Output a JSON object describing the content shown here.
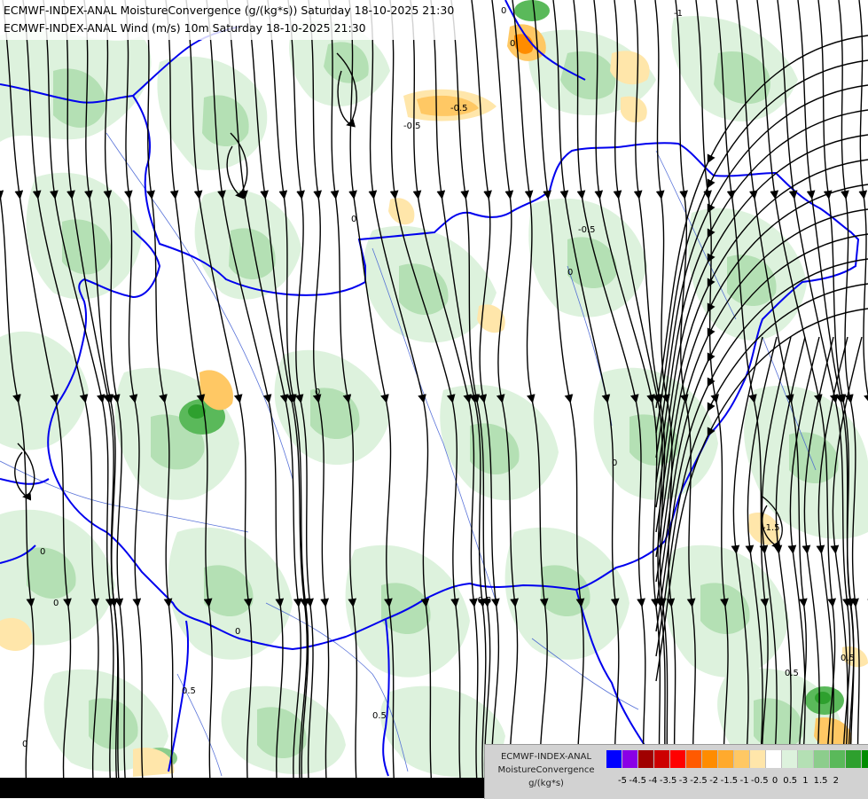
{
  "titles": {
    "line1": "ECMWF-INDEX-ANAL MoistureConvergence (g/(kg*s)) Saturday 18-10-2025 21:30",
    "line2": "ECMWF-INDEX-ANAL Wind (m/s) 10m Saturday 18-10-2025 21:30"
  },
  "legend": {
    "name_line1": "ECMWF-INDEX-ANAL",
    "name_line2": "MoistureConvergence",
    "units": "g/(kg*s)",
    "colors": [
      "#0000ff",
      "#8a00e6",
      "#a00000",
      "#cd0000",
      "#ff0000",
      "#ff5a00",
      "#ff8c00",
      "#ffaa2d",
      "#ffc864",
      "#ffe6aa",
      "#ffffff",
      "#ddf2dd",
      "#b4e0b4",
      "#8ccd8c",
      "#5ab95a",
      "#2ea02e",
      "#008c00"
    ],
    "ticks": [
      "-5",
      "-4.5",
      "-4",
      "-3.5",
      "-3",
      "-2.5",
      "-2",
      "-1.5",
      "-1",
      "-0.5",
      "0",
      "0.5",
      "1",
      "1.5",
      "2"
    ]
  },
  "map": {
    "contour_labels": [
      "0",
      "0",
      "0",
      "0",
      "0",
      "0",
      "0",
      "0",
      "0.5",
      "0.5",
      "0.5",
      "-0.5",
      "-0.5",
      "-1.5",
      "-0.5",
      "-1",
      "0",
      "-0.5",
      "0",
      "0.5"
    ],
    "palette": {
      "green_light": "#ddf2dd",
      "green_mid": "#b4e0b4",
      "green_dark": "#5ab95a",
      "green_deep": "#2ea02e",
      "orange_light": "#ffe6aa",
      "orange_mid": "#ffc864",
      "orange_dark": "#ff8c00",
      "border_blue": "#0000ee",
      "river_blue": "#3c5ad2",
      "streamline": "#000000"
    }
  }
}
